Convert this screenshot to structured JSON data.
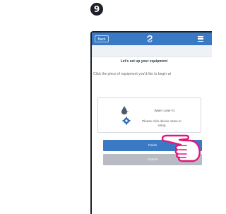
{
  "step": {
    "number": "9"
  },
  "app_bar": {
    "back_label": "Back",
    "logo_icon": "swirl-logo-icon",
    "menu_icon": "hamburger-menu-icon",
    "color": "#3a7ac4"
  },
  "header": {
    "title": "Let's set up your equipment"
  },
  "main": {
    "instruction": "Click the piece of equipment you'd like to begin wi",
    "equipment": {
      "name": "Water Leak #1",
      "hint": "Please click device name to setup",
      "icons": [
        "water-drop-icon",
        "gear-icon"
      ]
    }
  },
  "actions": {
    "finish_label": "Finish",
    "cancel_label": "Cancel"
  },
  "overlay": {
    "pointer_icon": "pointing-hand-icon",
    "outline_color": "#e0177b"
  }
}
